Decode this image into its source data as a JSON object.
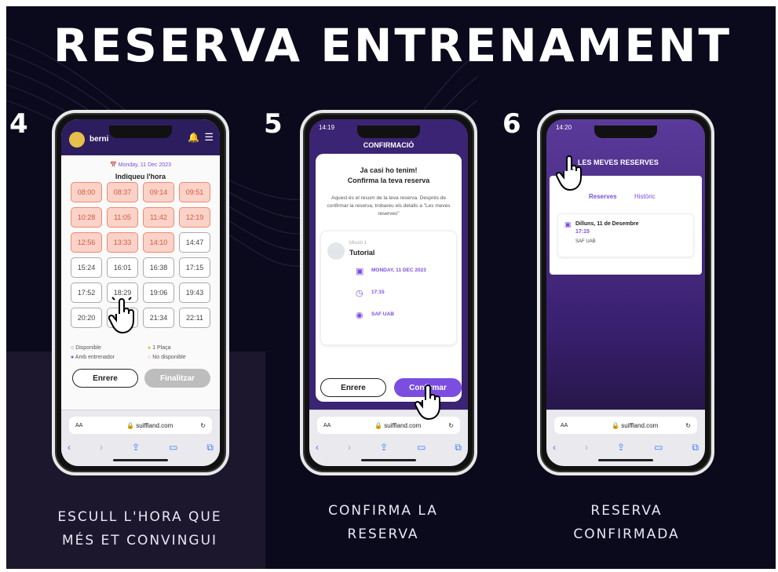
{
  "title": "RESERVA ENTRENAMENT",
  "steps": [
    {
      "number": "4",
      "caption_line1": "ESCULL L'HORA QUE",
      "caption_line2": "MÉS ET CONVINGUI"
    },
    {
      "number": "5",
      "caption_line1": "CONFIRMA LA",
      "caption_line2": "RESERVA"
    },
    {
      "number": "6",
      "caption_line1": "RESERVA",
      "caption_line2": "CONFIRMADA"
    }
  ],
  "phone1": {
    "username": "berni",
    "date": "Monday, 11 Dec 2023",
    "heading": "Indiqueu l'hora",
    "slots": [
      {
        "t": "08:00",
        "busy": true
      },
      {
        "t": "08:37",
        "busy": true
      },
      {
        "t": "09:14",
        "busy": true
      },
      {
        "t": "09:51",
        "busy": true
      },
      {
        "t": "10:28",
        "busy": true
      },
      {
        "t": "11:05",
        "busy": true
      },
      {
        "t": "11:42",
        "busy": true
      },
      {
        "t": "12:19",
        "busy": true
      },
      {
        "t": "12:56",
        "busy": true
      },
      {
        "t": "13:33",
        "busy": true
      },
      {
        "t": "14:10",
        "busy": true
      },
      {
        "t": "14:47",
        "busy": false
      },
      {
        "t": "15:24",
        "busy": false
      },
      {
        "t": "16:01",
        "busy": false
      },
      {
        "t": "16:38",
        "busy": false
      },
      {
        "t": "17:15",
        "busy": false
      },
      {
        "t": "17:52",
        "busy": false
      },
      {
        "t": "18:29",
        "busy": false
      },
      {
        "t": "19:06",
        "busy": false
      },
      {
        "t": "19:43",
        "busy": false
      },
      {
        "t": "20:20",
        "busy": false
      },
      {
        "t": "20:57",
        "busy": false
      },
      {
        "t": "21:34",
        "busy": false
      },
      {
        "t": "22:11",
        "busy": false
      }
    ],
    "legend": {
      "available": "Disponible",
      "one_place": "1 Plaça",
      "with_trainer": "Amb entrenador",
      "not_available": "No disponible"
    },
    "back_label": "Enrere",
    "finish_label": "Finalitzar",
    "url": "suiffland.com",
    "aa": "AA"
  },
  "phone2": {
    "time": "14:19",
    "header": "CONFIRMACIÓ",
    "heading1": "Ja casi ho tenim!",
    "heading2": "Confirma la teva reserva",
    "description": "Aquest és el resum de la teva reserva. Després de confirmar la reserva, trobareu els detalls a \"Les meves reserves\"",
    "mission": "Missió 1",
    "activity": "Tutorial",
    "date": "MONDAY, 11 DEC 2023",
    "hour": "17:15",
    "place": "SAF UAB",
    "back_label": "Enrere",
    "confirm_label": "Confirmar",
    "url": "suiffland.com",
    "aa": "AA"
  },
  "phone3": {
    "time": "14:20",
    "header": "LES MEVES RESERVES",
    "tab_reserves": "Reserves",
    "tab_history": "Històric",
    "booking_day": "Dilluns, 11 de Desembre",
    "booking_hour": "17:15",
    "booking_place": "SAF UAB",
    "url": "suiffland.com",
    "aa": "AA"
  },
  "colors": {
    "background": "#0b0a1c",
    "busy": "#fad2c8",
    "accent": "#7b4ee0",
    "header": "#2c1d5e"
  }
}
